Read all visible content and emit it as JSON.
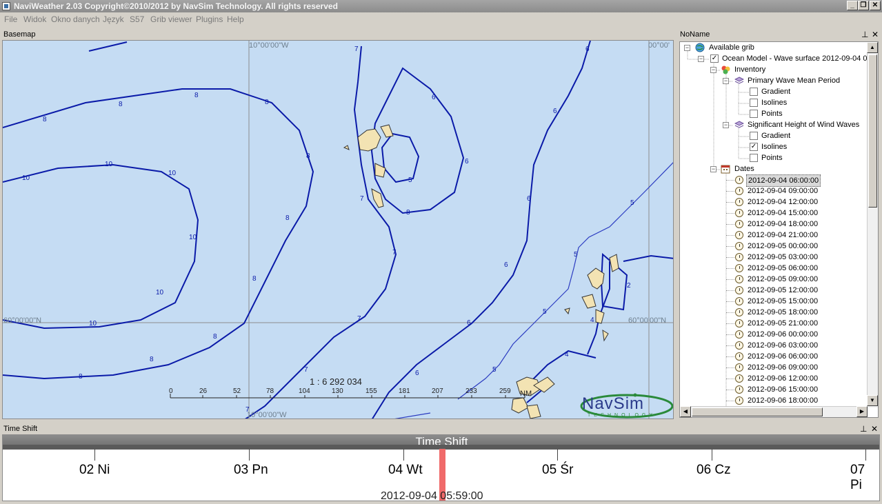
{
  "window": {
    "title": "NaviWeather 2.03 Copyright©2010/2012 by NavSim Technology. All rights reserved",
    "minimize": "_",
    "maximize": "▫",
    "close": "✕"
  },
  "menu": [
    "File",
    "Widok",
    "Okno danych",
    "Język",
    "S57",
    "Grib viewer",
    "Plugins",
    "Help"
  ],
  "basemap": {
    "panel_title": "Basemap",
    "scale_text": "1 : 6 292 034",
    "scale_ticks": [
      "0",
      "26",
      "52",
      "78",
      "104",
      "130",
      "155",
      "181",
      "207",
      "233",
      "259"
    ],
    "scale_unit": "NM",
    "grid_labels": {
      "top_left": "10°00'00\"W",
      "top_right": "00°00'",
      "mid_left": "60°00'00\"N",
      "mid_right": "60°00'00\"N",
      "bottom_left": "10°00'00\"W"
    },
    "logo_main": "NavSim",
    "logo_sub": "TECHNOLOGY",
    "colors": {
      "sea": "#c5dcf3",
      "isoline": "#0a1aa8",
      "land": "#f3e3b3"
    }
  },
  "tree_panel": {
    "title": "NoName",
    "nodes": {
      "available": "Available grib",
      "model": "Ocean Model  -  Wave surface 2012-09-04 0",
      "inventory": "Inventory",
      "param1": "Primary Wave Mean Period",
      "param1_children": [
        {
          "label": "Gradient",
          "checked": false
        },
        {
          "label": "Isolines",
          "checked": false
        },
        {
          "label": "Points",
          "checked": false
        }
      ],
      "param2": "Significant Height of Wind Waves",
      "param2_children": [
        {
          "label": "Gradient",
          "checked": false
        },
        {
          "label": "Isolines",
          "checked": true
        },
        {
          "label": "Points",
          "checked": false
        }
      ],
      "dates": "Dates",
      "date_items": [
        "2012-09-04 06:00:00",
        "2012-09-04 09:00:00",
        "2012-09-04 12:00:00",
        "2012-09-04 15:00:00",
        "2012-09-04 18:00:00",
        "2012-09-04 21:00:00",
        "2012-09-05 00:00:00",
        "2012-09-05 03:00:00",
        "2012-09-05 06:00:00",
        "2012-09-05 09:00:00",
        "2012-09-05 12:00:00",
        "2012-09-05 15:00:00",
        "2012-09-05 18:00:00",
        "2012-09-05 21:00:00",
        "2012-09-06 00:00:00",
        "2012-09-06 03:00:00",
        "2012-09-06 06:00:00",
        "2012-09-06 09:00:00",
        "2012-09-06 12:00:00",
        "2012-09-06 15:00:00",
        "2012-09-06 18:00:00"
      ],
      "selected_date": "2012-09-04 06:00:00"
    }
  },
  "timeshift": {
    "panel_title": "Time Shift",
    "bar_title": "Time Shift",
    "days": [
      "02 Ni",
      "03 Pn",
      "04 Wt",
      "05 Śr",
      "06 Cz",
      "07 Pi"
    ],
    "current": "2012-09-04 05:59:00"
  },
  "panel_icons": {
    "pin": "📌",
    "close": "✕"
  }
}
